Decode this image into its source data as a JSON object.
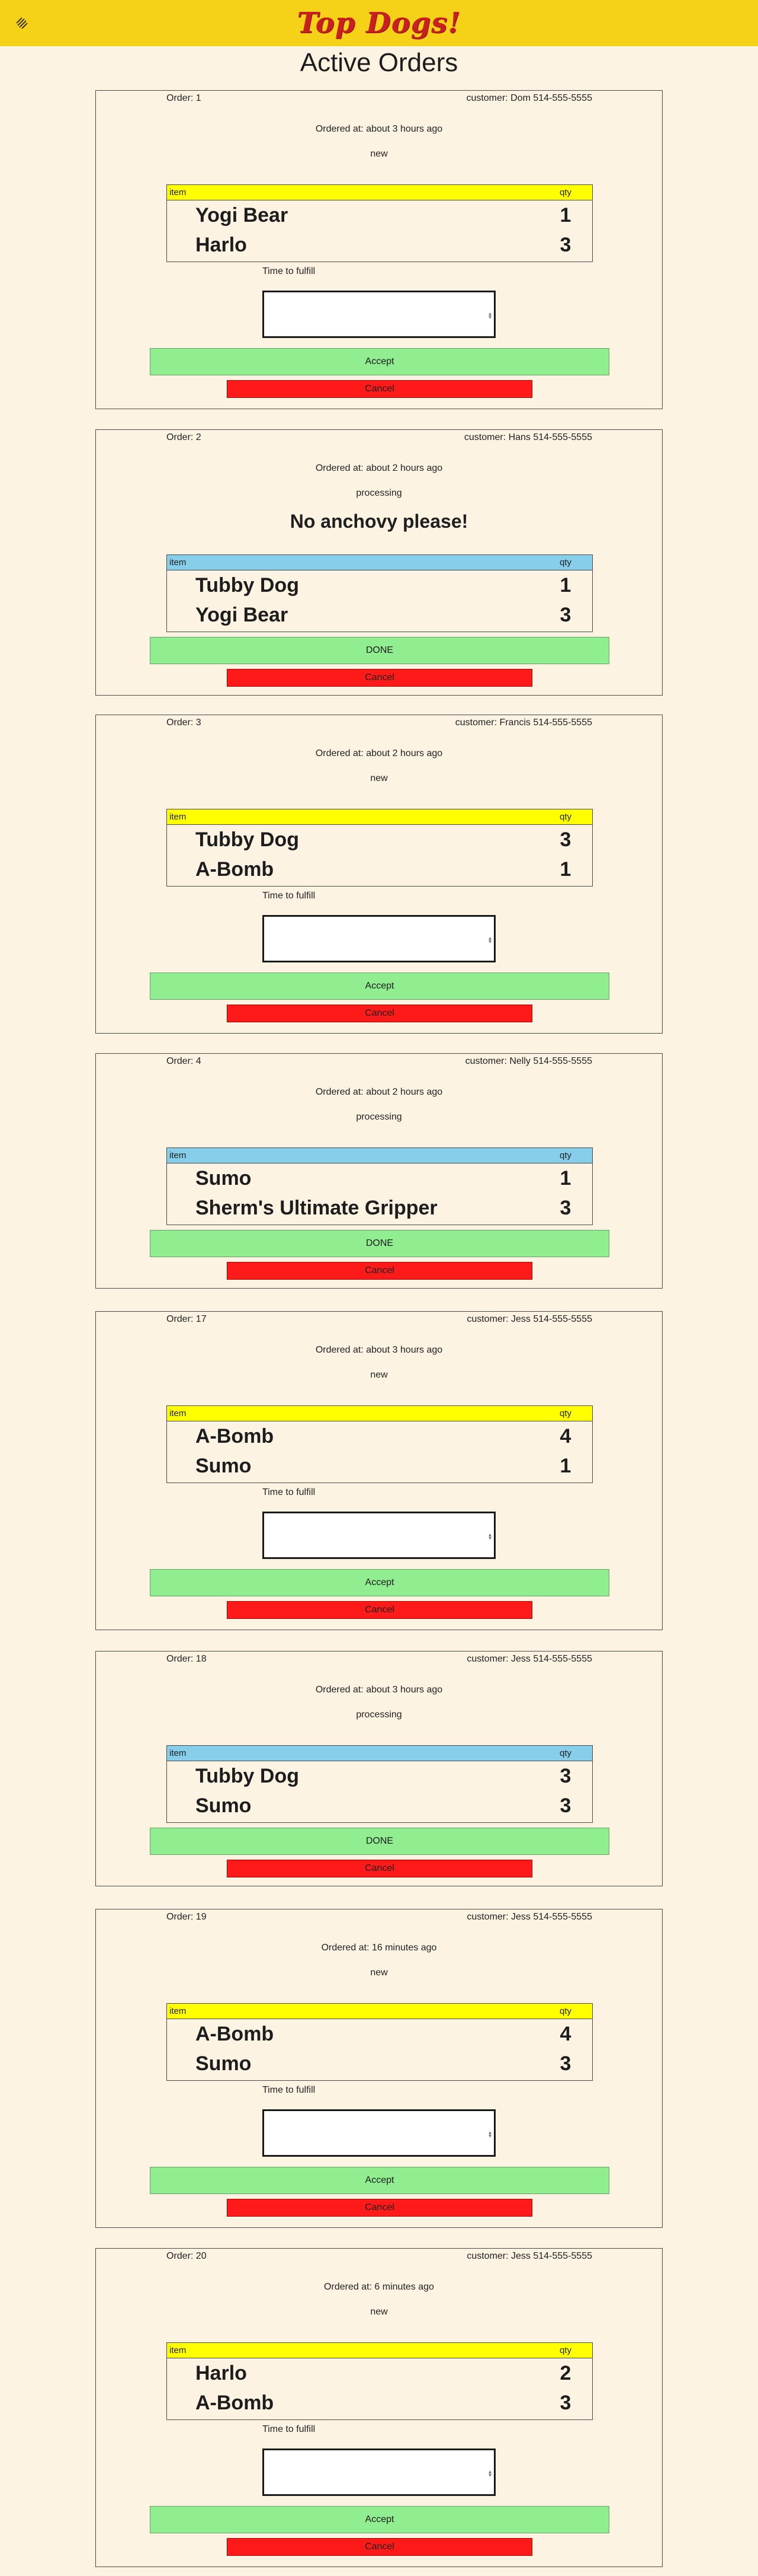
{
  "app": {
    "logo_text": "Top Dogs!",
    "menu_icon": "layers-icon",
    "brand_color": "#c8201f",
    "bar_color": "#f5d118",
    "background": "#fdf3e3"
  },
  "page": {
    "title": "Active Orders"
  },
  "labels": {
    "item_header": "item",
    "qty_header": "qty",
    "time_to_fulfill": "Time to fulfill",
    "accept": "Accept",
    "done": "DONE",
    "cancel": "Cancel"
  },
  "colors": {
    "new_header": "#ffff00",
    "processing_header": "#87ceeb",
    "accept_done_button": "#90ee90",
    "cancel_button": "#ff1a1a"
  },
  "orders": [
    {
      "order_label": "Order: 1",
      "customer": "customer: Dom 514-555-5555",
      "ordered_at": "Ordered at: about 3 hours ago",
      "status": "new",
      "note": "",
      "items": [
        {
          "name": "Yogi Bear",
          "qty": "1"
        },
        {
          "name": "Harlo",
          "qty": "3"
        }
      ]
    },
    {
      "order_label": "Order: 2",
      "customer": "customer: Hans 514-555-5555",
      "ordered_at": "Ordered at: about 2 hours ago",
      "status": "processing",
      "note": "No anchovy please!",
      "items": [
        {
          "name": "Tubby Dog",
          "qty": "1"
        },
        {
          "name": "Yogi Bear",
          "qty": "3"
        }
      ]
    },
    {
      "order_label": "Order: 3",
      "customer": "customer: Francis 514-555-5555",
      "ordered_at": "Ordered at: about 2 hours ago",
      "status": "new",
      "note": "",
      "items": [
        {
          "name": "Tubby Dog",
          "qty": "3"
        },
        {
          "name": "A-Bomb",
          "qty": "1"
        }
      ]
    },
    {
      "order_label": "Order: 4",
      "customer": "customer: Nelly 514-555-5555",
      "ordered_at": "Ordered at: about 2 hours ago",
      "status": "processing",
      "note": "",
      "items": [
        {
          "name": "Sumo",
          "qty": "1"
        },
        {
          "name": "Sherm's Ultimate Gripper",
          "qty": "3"
        }
      ]
    },
    {
      "order_label": "Order: 17",
      "customer": "customer: Jess 514-555-5555",
      "ordered_at": "Ordered at: about 3 hours ago",
      "status": "new",
      "note": "",
      "items": [
        {
          "name": "A-Bomb",
          "qty": "4"
        },
        {
          "name": "Sumo",
          "qty": "1"
        }
      ]
    },
    {
      "order_label": "Order: 18",
      "customer": "customer: Jess 514-555-5555",
      "ordered_at": "Ordered at: about 3 hours ago",
      "status": "processing",
      "note": "",
      "items": [
        {
          "name": "Tubby Dog",
          "qty": "3"
        },
        {
          "name": "Sumo",
          "qty": "3"
        }
      ]
    },
    {
      "order_label": "Order: 19",
      "customer": "customer: Jess 514-555-5555",
      "ordered_at": "Ordered at: 16 minutes ago",
      "status": "new",
      "note": "",
      "items": [
        {
          "name": "A-Bomb",
          "qty": "4"
        },
        {
          "name": "Sumo",
          "qty": "3"
        }
      ]
    },
    {
      "order_label": "Order: 20",
      "customer": "customer: Jess 514-555-5555",
      "ordered_at": "Ordered at: 6 minutes ago",
      "status": "new",
      "note": "",
      "items": [
        {
          "name": "Harlo",
          "qty": "2"
        },
        {
          "name": "A-Bomb",
          "qty": "3"
        }
      ]
    }
  ]
}
